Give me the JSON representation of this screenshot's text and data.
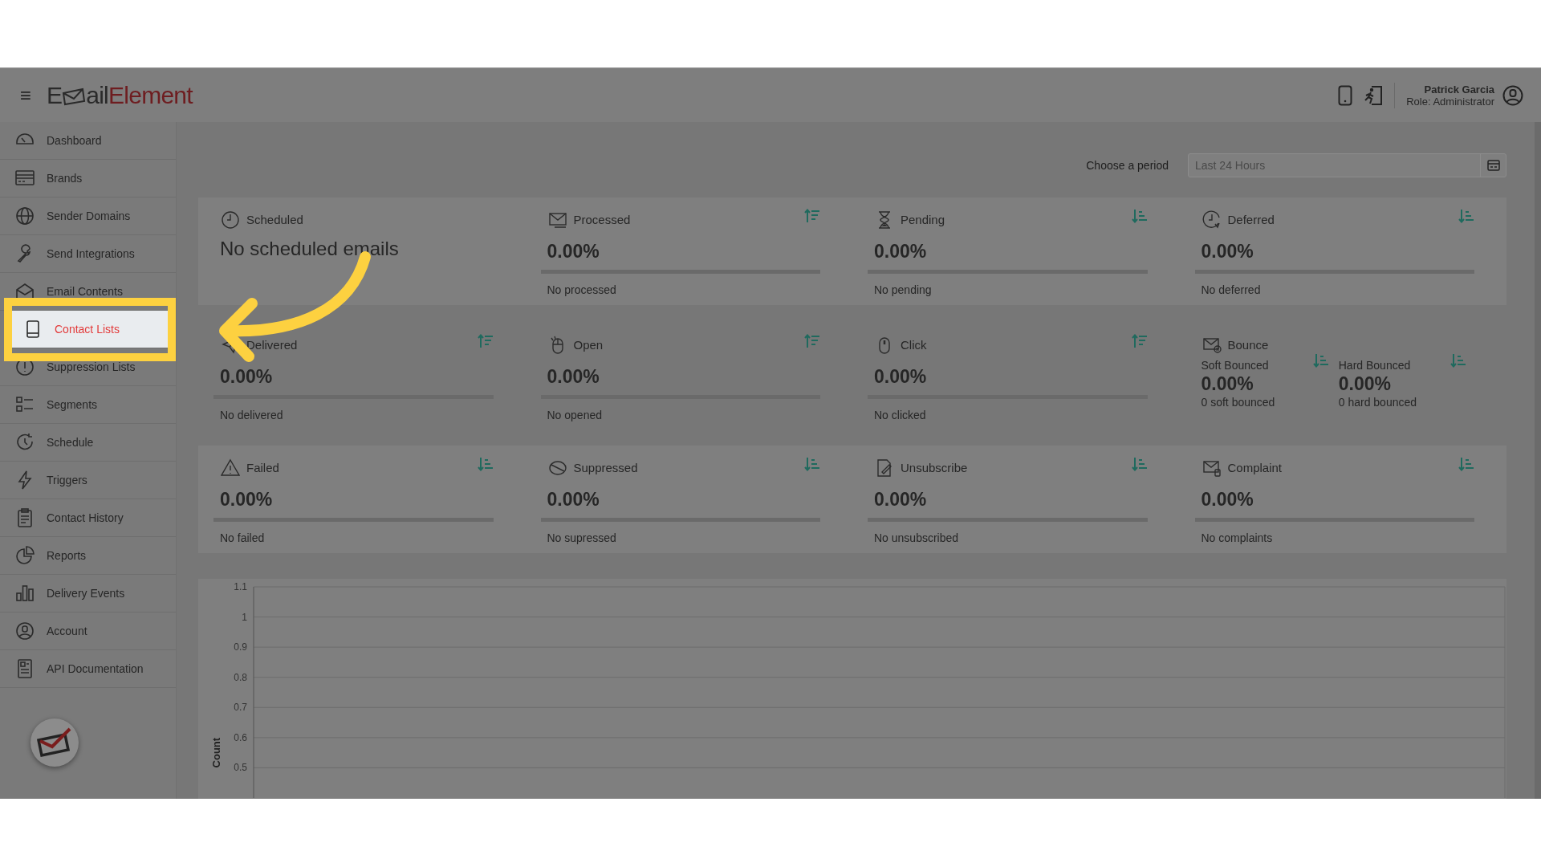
{
  "header": {
    "menu_glyph": "≡",
    "logo": {
      "start": "E",
      "middle": "ail",
      "end": "Element"
    },
    "user": {
      "name": "Patrick Garcia",
      "role": "Role: Administrator"
    }
  },
  "sidebar": {
    "items": [
      {
        "label": "Dashboard",
        "selected": false
      },
      {
        "label": "Brands",
        "selected": false
      },
      {
        "label": "Sender Domains",
        "selected": false
      },
      {
        "label": "Send Integrations",
        "selected": false
      },
      {
        "label": "Email Contents",
        "selected": false
      },
      {
        "label": "Contact Lists",
        "selected": true
      },
      {
        "label": "Suppression Lists",
        "selected": false
      },
      {
        "label": "Segments",
        "selected": false
      },
      {
        "label": "Schedule",
        "selected": false
      },
      {
        "label": "Triggers",
        "selected": false
      },
      {
        "label": "Contact History",
        "selected": false
      },
      {
        "label": "Reports",
        "selected": false
      },
      {
        "label": "Delivery Events",
        "selected": false
      },
      {
        "label": "Account",
        "selected": false
      },
      {
        "label": "API Documentation",
        "selected": false
      }
    ]
  },
  "period": {
    "label": "Choose a period",
    "placeholder": "Last 24 Hours"
  },
  "cards": [
    [
      {
        "kind": "message",
        "title": "Scheduled",
        "message": "No scheduled emails"
      },
      {
        "kind": "stat",
        "title": "Processed",
        "value": "0.00%",
        "level": 0,
        "note": "No processed",
        "ascending": true
      },
      {
        "kind": "stat",
        "title": "Pending",
        "value": "0.00%",
        "level": 0,
        "note": "No pending",
        "ascending": false
      },
      {
        "kind": "stat",
        "title": "Deferred",
        "value": "0.00%",
        "level": 0,
        "note": "No deferred",
        "ascending": false
      }
    ],
    [
      {
        "kind": "stat",
        "title": "Delivered",
        "value": "0.00%",
        "level": 0,
        "note": "No delivered",
        "ascending": true
      },
      {
        "kind": "stat",
        "title": "Open",
        "value": "0.00%",
        "level": 0,
        "note": "No opened",
        "ascending": true
      },
      {
        "kind": "stat",
        "title": "Click",
        "value": "0.00%",
        "level": 0,
        "note": "No clicked",
        "ascending": true
      },
      {
        "kind": "split",
        "title": "Bounce",
        "parts": [
          {
            "label": "Soft Bounced",
            "value": "0.00%",
            "note": "0 soft bounced",
            "ascending": false
          },
          {
            "label": "Hard Bounced",
            "value": "0.00%",
            "note": "0 hard bounced",
            "ascending": false
          }
        ]
      }
    ],
    [
      {
        "kind": "stat",
        "title": "Failed",
        "value": "0.00%",
        "level": 0,
        "note": "No failed",
        "ascending": false
      },
      {
        "kind": "stat",
        "title": "Suppressed",
        "value": "0.00%",
        "level": 0,
        "note": "No supressed",
        "ascending": false
      },
      {
        "kind": "stat",
        "title": "Unsubscribe",
        "value": "0.00%",
        "level": 0,
        "note": "No unsubscribed",
        "ascending": false
      },
      {
        "kind": "stat",
        "title": "Complaint",
        "value": "0.00%",
        "level": 0,
        "note": "No complaints",
        "ascending": false
      }
    ]
  ],
  "chart": {
    "chart_data": {
      "type": "line",
      "categories": [
        null,
        null
      ],
      "series": [
        {
          "values": [
            null,
            null
          ]
        }
      ],
      "ylabel": "Count",
      "grid": true,
      "ylim": [
        0.4,
        1.1
      ],
      "yticks": [
        0.5,
        0.6,
        0.7,
        0.8,
        0.9,
        1,
        1.1
      ]
    }
  }
}
